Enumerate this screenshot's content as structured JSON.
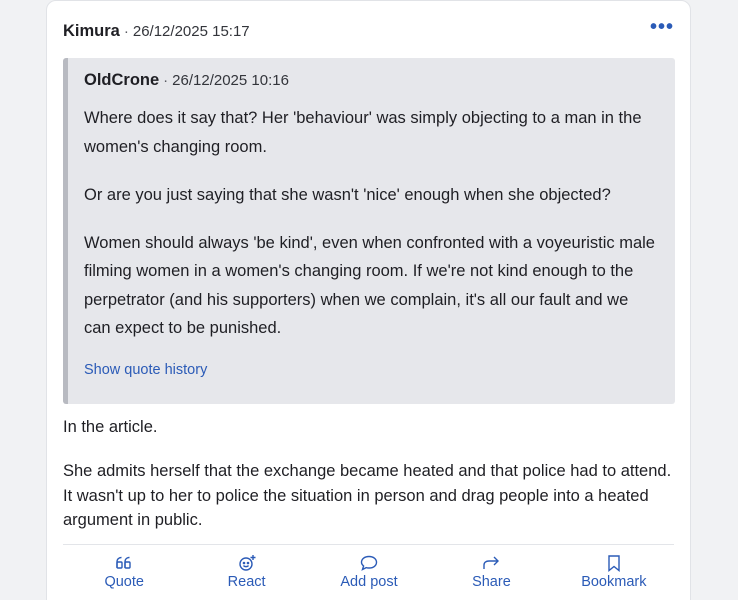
{
  "post": {
    "author": "Kimura",
    "separator": "·",
    "timestamp": "26/12/2025 15:17",
    "more_label": "•••",
    "quote": {
      "author": "OldCrone",
      "timestamp": "26/12/2025 10:16",
      "paragraphs": [
        "Where does it say that? Her 'behaviour' was simply objecting to a man in the women's changing room.",
        "Or are you just saying that she wasn't 'nice' enough when she objected?",
        "Women should always 'be kind', even when confronted with a voyeuristic male filming women in a women's changing room. If we're not kind enough to the perpetrator (and his supporters) when we complain, it's all our fault and we can expect to be punished."
      ],
      "history_link": "Show quote history"
    },
    "paragraphs": [
      "In the article.",
      "She admits herself that the exchange became heated and that police had to attend. It wasn't up to her to police the situation in person and drag people into a heated argument in public."
    ]
  },
  "actions": [
    {
      "label": "Quote",
      "icon": "quote-icon"
    },
    {
      "label": "React",
      "icon": "react-icon"
    },
    {
      "label": "Add post",
      "icon": "add-post-icon"
    },
    {
      "label": "Share",
      "icon": "share-icon"
    },
    {
      "label": "Bookmark",
      "icon": "bookmark-icon"
    }
  ],
  "colors": {
    "accent": "#2b5bb7",
    "quote_background": "#e6e7eb",
    "quote_bar": "#b8bac1",
    "page_background": "#f1f2f4"
  }
}
